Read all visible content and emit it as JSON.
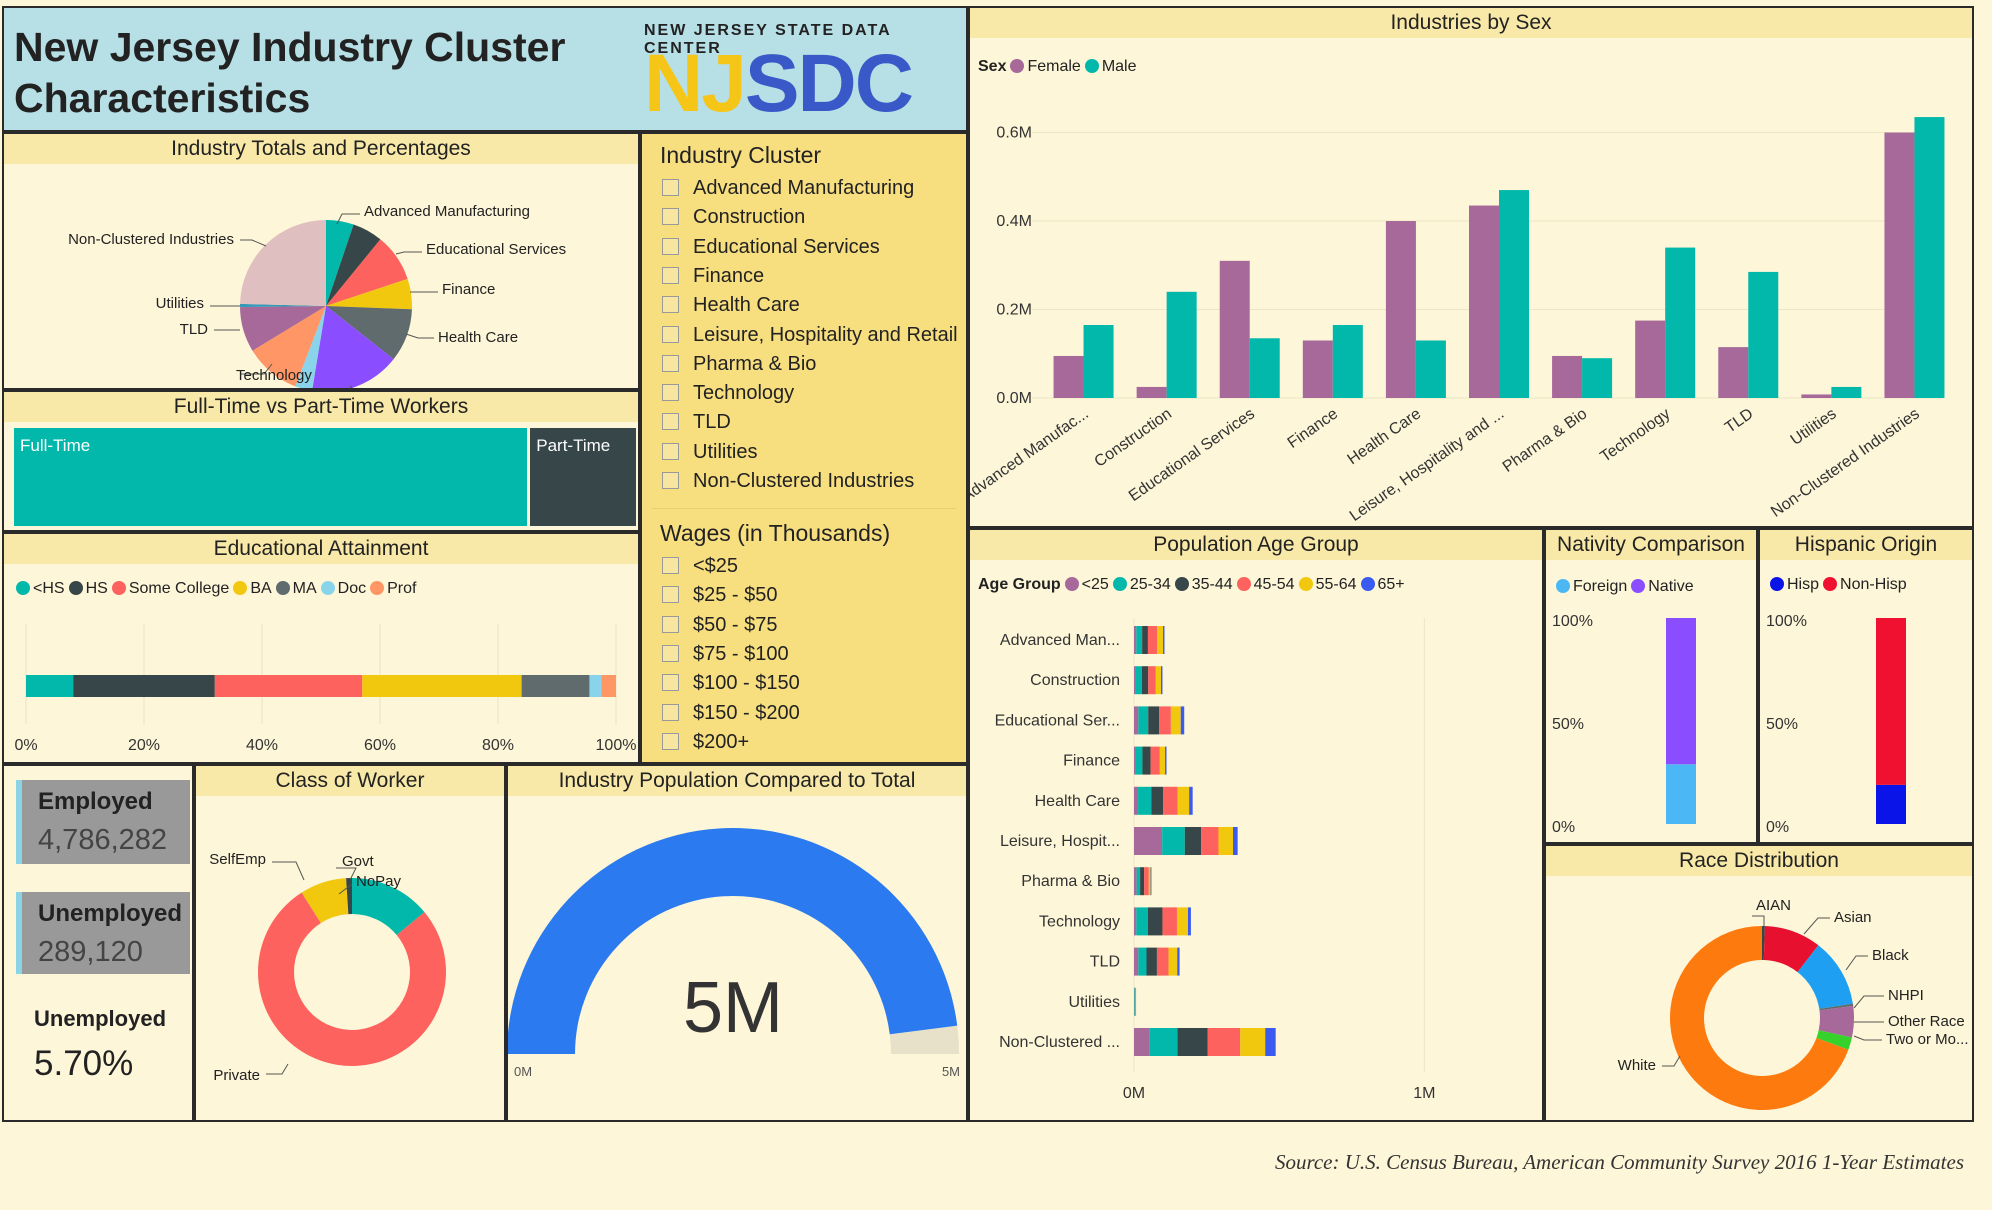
{
  "header": {
    "title_line1": "New Jersey Industry Cluster",
    "title_line2": "Characteristics",
    "logo_top": "NEW JERSEY STATE DATA CENTER",
    "logo_a": "NJ",
    "logo_b": "SDC"
  },
  "panels": {
    "industry_totals": "Industry Totals and Percentages",
    "ft_pt": "Full-Time vs Part-Time Workers",
    "education": "Educational Attainment",
    "class_worker": "Class of Worker",
    "gauge": "Industry Population Compared to Total",
    "by_sex": "Industries by Sex",
    "age": "Population Age Group",
    "nativity": "Nativity Comparison",
    "hispanic": "Hispanic Origin",
    "race": "Race Distribution"
  },
  "slicers": {
    "cluster_title": "Industry Cluster",
    "cluster_items": [
      "Advanced Manufacturing",
      "Construction",
      "Educational Services",
      "Finance",
      "Health Care",
      "Leisure, Hospitality and Retail",
      "Pharma & Bio",
      "Technology",
      "TLD",
      "Utilities",
      "Non-Clustered Industries"
    ],
    "wage_title": "Wages (in Thousands)",
    "wage_items": [
      "<$25",
      "$25 - $50",
      "$50 - $75",
      "$75 - $100",
      "$100 - $150",
      "$150 - $200",
      "$200+"
    ]
  },
  "cards": {
    "employed_label": "Employed",
    "employed_value": "4,786,282",
    "unemployed_label": "Unemployed",
    "unemployed_value": "289,120",
    "rate_label": "Unemployed",
    "rate_value": "5.70%"
  },
  "source": "Source: U.S. Census Bureau, American Community Survey 2016 1-Year Estimates",
  "colors": {
    "teal": "#01b8aa",
    "dark": "#374649",
    "red": "#fd625e",
    "yellow": "#f2c80f",
    "gray": "#5f6b6d",
    "lightblue": "#8ad4eb",
    "orange": "#fe9666",
    "purple": "#a66999",
    "blue": "#3599b8",
    "pink": "#dfbfbf",
    "violet": "#8a4dff",
    "lightgray": "#b8e0ea"
  },
  "chart_data": [
    {
      "id": "industry_totals",
      "type": "pie",
      "labels": [
        "Advanced Manufacturing",
        "Educational Services",
        "Finance",
        "Health Care",
        "Leisure, Hospitality and Retail",
        "Technology",
        "TLD",
        "Utilities",
        "Non-Clustered Industries"
      ],
      "slices": [
        {
          "label": "Advanced Manufacturing",
          "value": 5.2,
          "color": "#01b8aa"
        },
        {
          "label": "",
          "value": 5.7,
          "color": "#374649"
        },
        {
          "label": "Educational Services",
          "value": 9.0,
          "color": "#fd625e"
        },
        {
          "label": "Finance",
          "value": 5.7,
          "color": "#f2c80f"
        },
        {
          "label": "Health Care",
          "value": 10.0,
          "color": "#5f6b6d"
        },
        {
          "label": "Leisure, Hospitality and Retail",
          "value": 17.0,
          "color": "#8a4dff"
        },
        {
          "label": "",
          "value": 3.2,
          "color": "#8ad4eb"
        },
        {
          "label": "Technology",
          "value": 10.5,
          "color": "#fe9666"
        },
        {
          "label": "TLD",
          "value": 8.5,
          "color": "#a66999"
        },
        {
          "label": "Utilities",
          "value": 0.6,
          "color": "#3599b8"
        },
        {
          "label": "Non-Clustered Industries",
          "value": 24.6,
          "color": "#dfbfbf"
        }
      ]
    },
    {
      "id": "ft_pt",
      "type": "treemap",
      "items": [
        {
          "label": "Full-Time",
          "value": 83,
          "color": "#01b8aa"
        },
        {
          "label": "Part-Time",
          "value": 17,
          "color": "#374649"
        }
      ]
    },
    {
      "id": "education",
      "type": "bar",
      "stacked": true,
      "percent": true,
      "legend": [
        "<HS",
        "HS",
        "Some College",
        "BA",
        "MA",
        "Doc",
        "Prof"
      ],
      "values": [
        8,
        24,
        25,
        27,
        11.5,
        2,
        2.5
      ],
      "colors": [
        "#01b8aa",
        "#374649",
        "#fd625e",
        "#f2c80f",
        "#5f6b6d",
        "#8ad4eb",
        "#fe9666"
      ],
      "ticks": [
        "0%",
        "20%",
        "40%",
        "60%",
        "80%",
        "100%"
      ]
    },
    {
      "id": "class_worker",
      "type": "pie",
      "donut": true,
      "slices": [
        {
          "label": "Govt",
          "value": 14,
          "color": "#01b8aa"
        },
        {
          "label": "Private",
          "value": 77,
          "color": "#fd625e"
        },
        {
          "label": "SelfEmp",
          "value": 8,
          "color": "#f2c80f"
        },
        {
          "label": "NoPay",
          "value": 1,
          "color": "#374649"
        }
      ]
    },
    {
      "id": "gauge",
      "type": "gauge",
      "value": 4.8,
      "min": 0,
      "max": 5,
      "display": "5M",
      "min_label": "0M",
      "max_label": "5M",
      "color": "#2b7af0"
    },
    {
      "id": "by_sex",
      "type": "bar",
      "legend_title": "Sex",
      "categories": [
        "Advanced Manufac...",
        "Construction",
        "Educational Services",
        "Finance",
        "Health Care",
        "Leisure, Hospitality and ...",
        "Pharma & Bio",
        "Technology",
        "TLD",
        "Utilities",
        "Non-Clustered Industries"
      ],
      "series": [
        {
          "name": "Female",
          "color": "#a66999",
          "values": [
            0.095,
            0.025,
            0.31,
            0.13,
            0.4,
            0.435,
            0.095,
            0.175,
            0.115,
            0.008,
            0.6
          ]
        },
        {
          "name": "Male",
          "color": "#01b8aa",
          "values": [
            0.165,
            0.24,
            0.135,
            0.165,
            0.13,
            0.47,
            0.09,
            0.34,
            0.285,
            0.025,
            0.635
          ]
        }
      ],
      "ylim": [
        0,
        0.66
      ],
      "yticks": [
        {
          "v": 0,
          "t": "0.0M"
        },
        {
          "v": 0.2,
          "t": "0.2M"
        },
        {
          "v": 0.4,
          "t": "0.4M"
        },
        {
          "v": 0.6,
          "t": "0.6M"
        }
      ]
    },
    {
      "id": "age",
      "type": "bar",
      "orientation": "horizontal",
      "stacked": true,
      "legend_title": "Age Group",
      "categories": [
        "Advanced Man...",
        "Construction",
        "Educational Ser...",
        "Finance",
        "Health Care",
        "Leisure, Hospit...",
        "Pharma & Bio",
        "Technology",
        "TLD",
        "Utilities",
        "Non-Clustered ..."
      ],
      "series": [
        {
          "name": "<25",
          "color": "#a66999",
          "values": [
            8,
            5,
            15,
            5,
            14,
            97,
            9,
            8,
            15,
            1,
            54
          ]
        },
        {
          "name": "25-34",
          "color": "#01b8aa",
          "values": [
            20,
            22,
            34,
            24,
            46,
            78,
            12,
            40,
            28,
            2,
            96
          ]
        },
        {
          "name": "35-44",
          "color": "#374649",
          "values": [
            20,
            22,
            38,
            28,
            40,
            56,
            14,
            50,
            36,
            1,
            104
          ]
        },
        {
          "name": "45-54",
          "color": "#fd625e",
          "values": [
            32,
            26,
            40,
            32,
            50,
            60,
            16,
            50,
            40,
            1,
            112
          ]
        },
        {
          "name": "55-64",
          "color": "#f2c80f",
          "values": [
            20,
            18,
            34,
            18,
            40,
            50,
            6,
            38,
            30,
            1,
            86
          ]
        },
        {
          "name": "65+",
          "color": "#3a5af0",
          "values": [
            5,
            5,
            12,
            5,
            12,
            16,
            3,
            10,
            8,
            1,
            36
          ]
        }
      ],
      "xmax": 1240,
      "xticks": [
        {
          "v": 0,
          "t": "0M"
        },
        {
          "v": 1000,
          "t": "1M"
        }
      ]
    },
    {
      "id": "nativity",
      "type": "bar",
      "stacked": true,
      "percent": true,
      "series": [
        {
          "name": "Foreign",
          "color": "#4bb7f5",
          "value": 29
        },
        {
          "name": "Native",
          "color": "#8a4dff",
          "value": 71
        }
      ],
      "yticks": [
        "100%",
        "50%",
        "0%"
      ]
    },
    {
      "id": "hispanic",
      "type": "bar",
      "stacked": true,
      "percent": true,
      "series": [
        {
          "name": "Hisp",
          "color": "#0a14e8",
          "value": 19
        },
        {
          "name": "Non-Hisp",
          "color": "#f0102f",
          "value": 81
        }
      ],
      "yticks": [
        "100%",
        "50%",
        "0%"
      ]
    },
    {
      "id": "race",
      "type": "pie",
      "donut": true,
      "slices": [
        {
          "label": "AIAN",
          "value": 0.5,
          "color": "#374649"
        },
        {
          "label": "Asian",
          "value": 10,
          "color": "#e8102f"
        },
        {
          "label": "Black",
          "value": 12,
          "color": "#1e9ff2"
        },
        {
          "label": "NHPI",
          "value": 0.4,
          "color": "#5f6b6d"
        },
        {
          "label": "Other Race",
          "value": 5.5,
          "color": "#a66999"
        },
        {
          "label": "Two or Mo...",
          "value": 2.2,
          "color": "#37d12c"
        },
        {
          "label": "White",
          "value": 69.4,
          "color": "#fd7a0f"
        }
      ]
    }
  ]
}
